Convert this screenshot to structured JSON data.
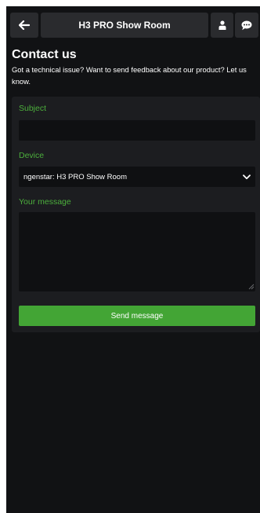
{
  "header": {
    "title": "H3 PRO Show Room",
    "back_icon": "arrow-left-icon",
    "user_icon": "user-icon",
    "chat_icon": "chat-bubble-icon"
  },
  "contact": {
    "title": "Contact us",
    "description": "Got a technical issue? Want to send feedback about our product? Let us know."
  },
  "form": {
    "subject_label": "Subject",
    "subject_value": "",
    "device_label": "Device",
    "device_selected": "ngenstar: H3 PRO Show Room",
    "message_label": "Your message",
    "message_value": "",
    "send_label": "Send message"
  },
  "colors": {
    "background": "#111214",
    "card": "#1c1d20",
    "input": "#0f1012",
    "accent_green": "#4caf3c",
    "button_green": "#43a535"
  }
}
